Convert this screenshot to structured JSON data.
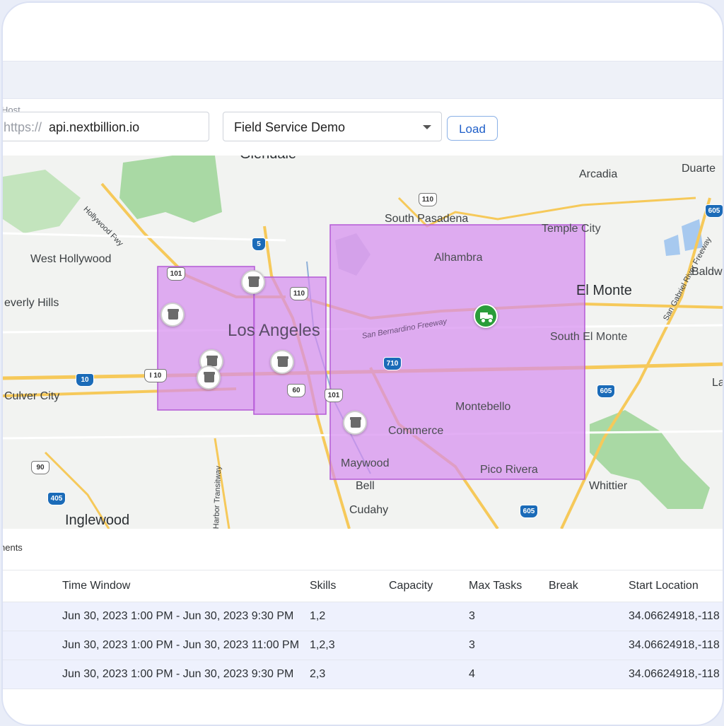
{
  "host": {
    "label": "Host",
    "prefix": "https://",
    "value": "api.nextbillion.io"
  },
  "dataset": {
    "selected": "Field Service Demo"
  },
  "load_label": "Load",
  "map": {
    "labels": {
      "glendale": "Glendale",
      "arcadia": "Arcadia",
      "duarte": "Duarte",
      "south_pasadena": "South Pasadena",
      "temple_city": "Temple City",
      "west_hollywood": "West Hollywood",
      "alhambra": "Alhambra",
      "el_monte": "El Monte",
      "baldwin": "Baldw",
      "beverly_hills": "everly Hills",
      "los_angeles": "Los Angeles",
      "south_el_monte": "South El Monte",
      "culver_city": "Culver City",
      "montebello": "Montebello",
      "commerce": "Commerce",
      "maywood": "Maywood",
      "pico_rivera": "Pico Rivera",
      "bell": "Bell",
      "whittier": "Whittier",
      "cudahy": "Cudahy",
      "inglewood": "Inglewood",
      "la_edge": "La",
      "hollywood_fwy": "Hollywood Fwy",
      "san_bernardino_fwy": "San Bernardino Freeway",
      "san_gabriel_fwy": "San Gabriel River Freeway",
      "harbor_transitway": "Harbor Transitway",
      "i10_label": "I 10"
    },
    "shields": {
      "s110a": "110",
      "s605a": "605",
      "s5": "5",
      "s101a": "101",
      "s110b": "110",
      "s10": "10",
      "s710": "710",
      "s60": "60",
      "s101b": "101",
      "s605b": "605",
      "s90": "90",
      "s405": "405",
      "s605c": "605"
    }
  },
  "section_label": "nents",
  "table": {
    "headers": [
      "Time Window",
      "Skills",
      "Capacity",
      "Max Tasks",
      "Break",
      "Start Location"
    ],
    "rows": [
      [
        "Jun 30, 2023 1:00 PM - Jun 30, 2023 9:30 PM",
        "1,2",
        "",
        "3",
        "",
        "34.06624918,-118"
      ],
      [
        "Jun 30, 2023 1:00 PM - Jun 30, 2023 11:00 PM",
        "1,2,3",
        "",
        "3",
        "",
        "34.06624918,-118"
      ],
      [
        "Jun 30, 2023 1:00 PM - Jun 30, 2023 9:30 PM",
        "2,3",
        "",
        "4",
        "",
        "34.06624918,-118"
      ]
    ]
  },
  "colors": {
    "zone_fill": "#d58cf0",
    "zone_stroke": "#b45ad6",
    "truck": "#2a9d3a",
    "accent": "#1f5fc9"
  }
}
